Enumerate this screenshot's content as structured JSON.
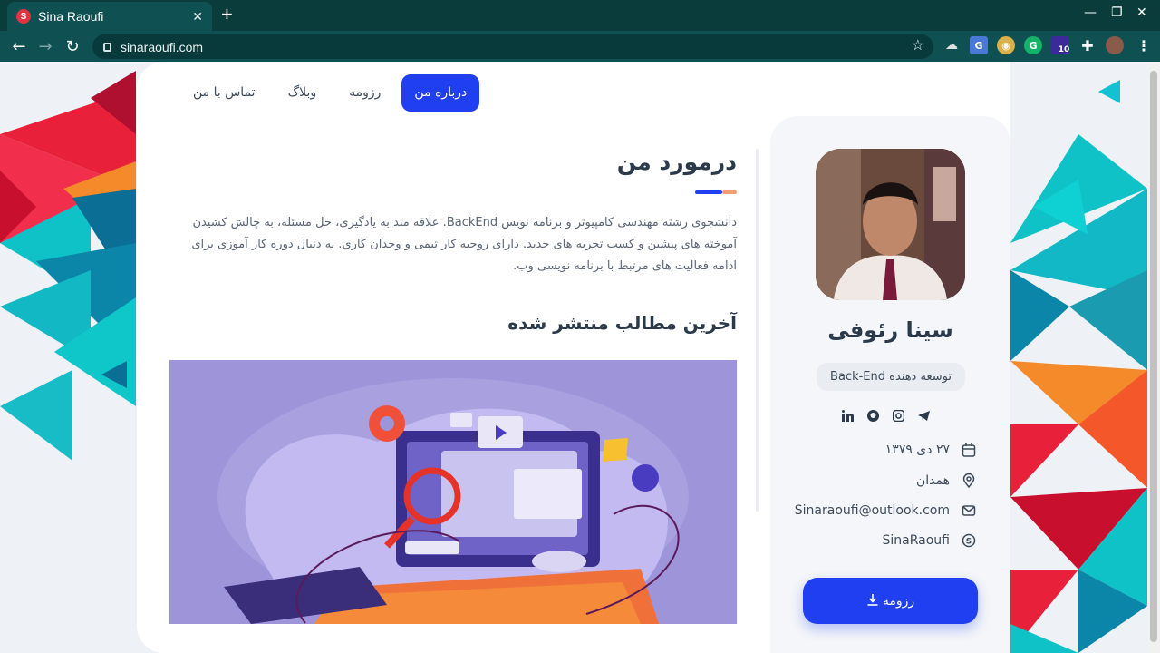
{
  "browser": {
    "tab_title": "Sina Raoufi",
    "favicon_letter": "S",
    "url": "sinaraoufi.com",
    "extension_badge": "10"
  },
  "nav": {
    "items": [
      {
        "label": "درباره من",
        "active": true
      },
      {
        "label": "رزومه",
        "active": false
      },
      {
        "label": "وبلاگ",
        "active": false
      },
      {
        "label": "تماس با من",
        "active": false
      }
    ]
  },
  "main": {
    "title": "درمورد من",
    "about": "دانشجوی رشته مهندسی کامپیوتر و برنامه نویس BackEnd. علاقه مند به یادگیری، حل مسئله، به چالش کشیدن آموخته های پیشین و کسب تجربه های جدید. دارای روحیه کار تیمی و وجدان کاری. به دنبال دوره کار آموزی برای ادامه فعالیت های مرتبط با برنامه نویسی وب.",
    "posts_title": "آخرین مطالب منتشر شده"
  },
  "profile": {
    "name": "سینا رئوفی",
    "role": "توسعه دهنده Back-End",
    "birthday": "۲۷ دی ۱۳۷۹",
    "city": "همدان",
    "email": "Sinaraoufi@outlook.com",
    "skype": "SinaRaoufi",
    "cv_button": "رزومه"
  },
  "colors": {
    "accent": "#1f3ff0",
    "underline_orange": "#f0a070",
    "heading": "#2b3a4a",
    "chrome": "#0f5052"
  }
}
